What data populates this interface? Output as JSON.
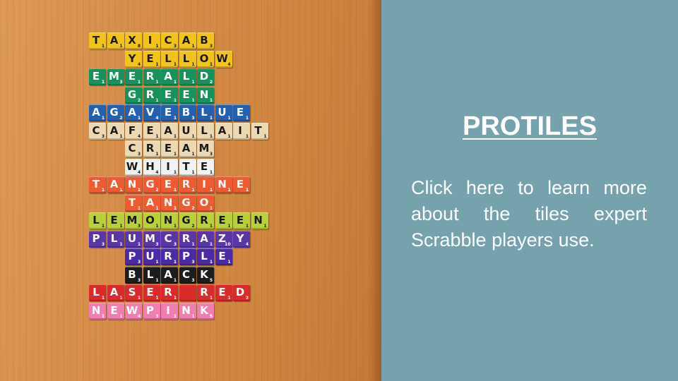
{
  "slide": {
    "title": "PROTILES",
    "body": "Click here to learn more about the tiles expert Scrabble players use."
  },
  "tile_rows": [
    {
      "word": "TAXICAB",
      "color": "#f0c419",
      "ink": "#1a1a1a",
      "offset": 0,
      "points": [
        "1",
        "1",
        "8",
        "1",
        "3",
        "1",
        "3"
      ]
    },
    {
      "word": "YELLOW",
      "color": "#f0c419",
      "ink": "#1a1a1a",
      "offset": 2,
      "points": [
        "4",
        "1",
        "1",
        "1",
        "1",
        "4"
      ]
    },
    {
      "word": "EMERALD",
      "color": "#17925c",
      "ink": "#ffffff",
      "offset": 0,
      "points": [
        "1",
        "3",
        "1",
        "1",
        "1",
        "1",
        "2"
      ]
    },
    {
      "word": "GREEN",
      "color": "#17925c",
      "ink": "#ffffff",
      "offset": 2,
      "points": [
        "2",
        "1",
        "1",
        "1",
        "1"
      ]
    },
    {
      "word": "AGAVEBLUE",
      "color": "#2360b0",
      "ink": "#ffffff",
      "offset": 0,
      "points": [
        "1",
        "2",
        "1",
        "4",
        "1",
        "3",
        "1",
        "1",
        "1"
      ]
    },
    {
      "word": "CAFEAULAIT",
      "color": "#ecd9b3",
      "ink": "#1a1a1a",
      "offset": 0,
      "points": [
        "3",
        "1",
        "4",
        "1",
        "1",
        "1",
        "1",
        "1",
        "1",
        "1"
      ]
    },
    {
      "word": "CREAM",
      "color": "#ecd9b3",
      "ink": "#1a1a1a",
      "offset": 2,
      "points": [
        "3",
        "1",
        "1",
        "1",
        "3"
      ]
    },
    {
      "word": "WHITE",
      "color": "#f2f2f2",
      "ink": "#1a1a1a",
      "offset": 2,
      "points": [
        "4",
        "4",
        "1",
        "1",
        "1"
      ]
    },
    {
      "word": "TANGERINE",
      "color": "#ee5a32",
      "ink": "#ffffff",
      "offset": 0,
      "points": [
        "1",
        "1",
        "1",
        "2",
        "1",
        "1",
        "1",
        "1",
        "1"
      ]
    },
    {
      "word": "TANGO",
      "color": "#ee5a32",
      "ink": "#ffffff",
      "offset": 2,
      "points": [
        "1",
        "1",
        "1",
        "2",
        "1"
      ]
    },
    {
      "word": "LEMONGREEN",
      "color": "#b9d03d",
      "ink": "#1a1a1a",
      "offset": 0,
      "points": [
        "1",
        "1",
        "3",
        "1",
        "1",
        "2",
        "1",
        "1",
        "1",
        "1"
      ]
    },
    {
      "word": "PLUMCRAZY",
      "color": "#5a36a8",
      "ink": "#ffffff",
      "offset": 0,
      "points": [
        "3",
        "1",
        "1",
        "3",
        "3",
        "1",
        "1",
        "10",
        "4"
      ]
    },
    {
      "word": "PURPLE",
      "color": "#4b2aa6",
      "ink": "#ffffff",
      "offset": 2,
      "points": [
        "3",
        "1",
        "1",
        "3",
        "1",
        "1"
      ]
    },
    {
      "word": "BLACK",
      "color": "#1c1c1c",
      "ink": "#ffffff",
      "offset": 2,
      "points": [
        "3",
        "1",
        "1",
        "3",
        "5"
      ]
    },
    {
      "word": "LASER RED",
      "color": "#d92b2b",
      "ink": "#ffffff",
      "offset": 0,
      "points": [
        "1",
        "1",
        "1",
        "1",
        "1",
        "",
        "1",
        "1",
        "2"
      ]
    },
    {
      "word": "NEWPINK",
      "color": "#f07fb0",
      "ink": "#ffffff",
      "offset": 0,
      "points": [
        "1",
        "1",
        "4",
        "3",
        "1",
        "1",
        "5"
      ]
    }
  ]
}
